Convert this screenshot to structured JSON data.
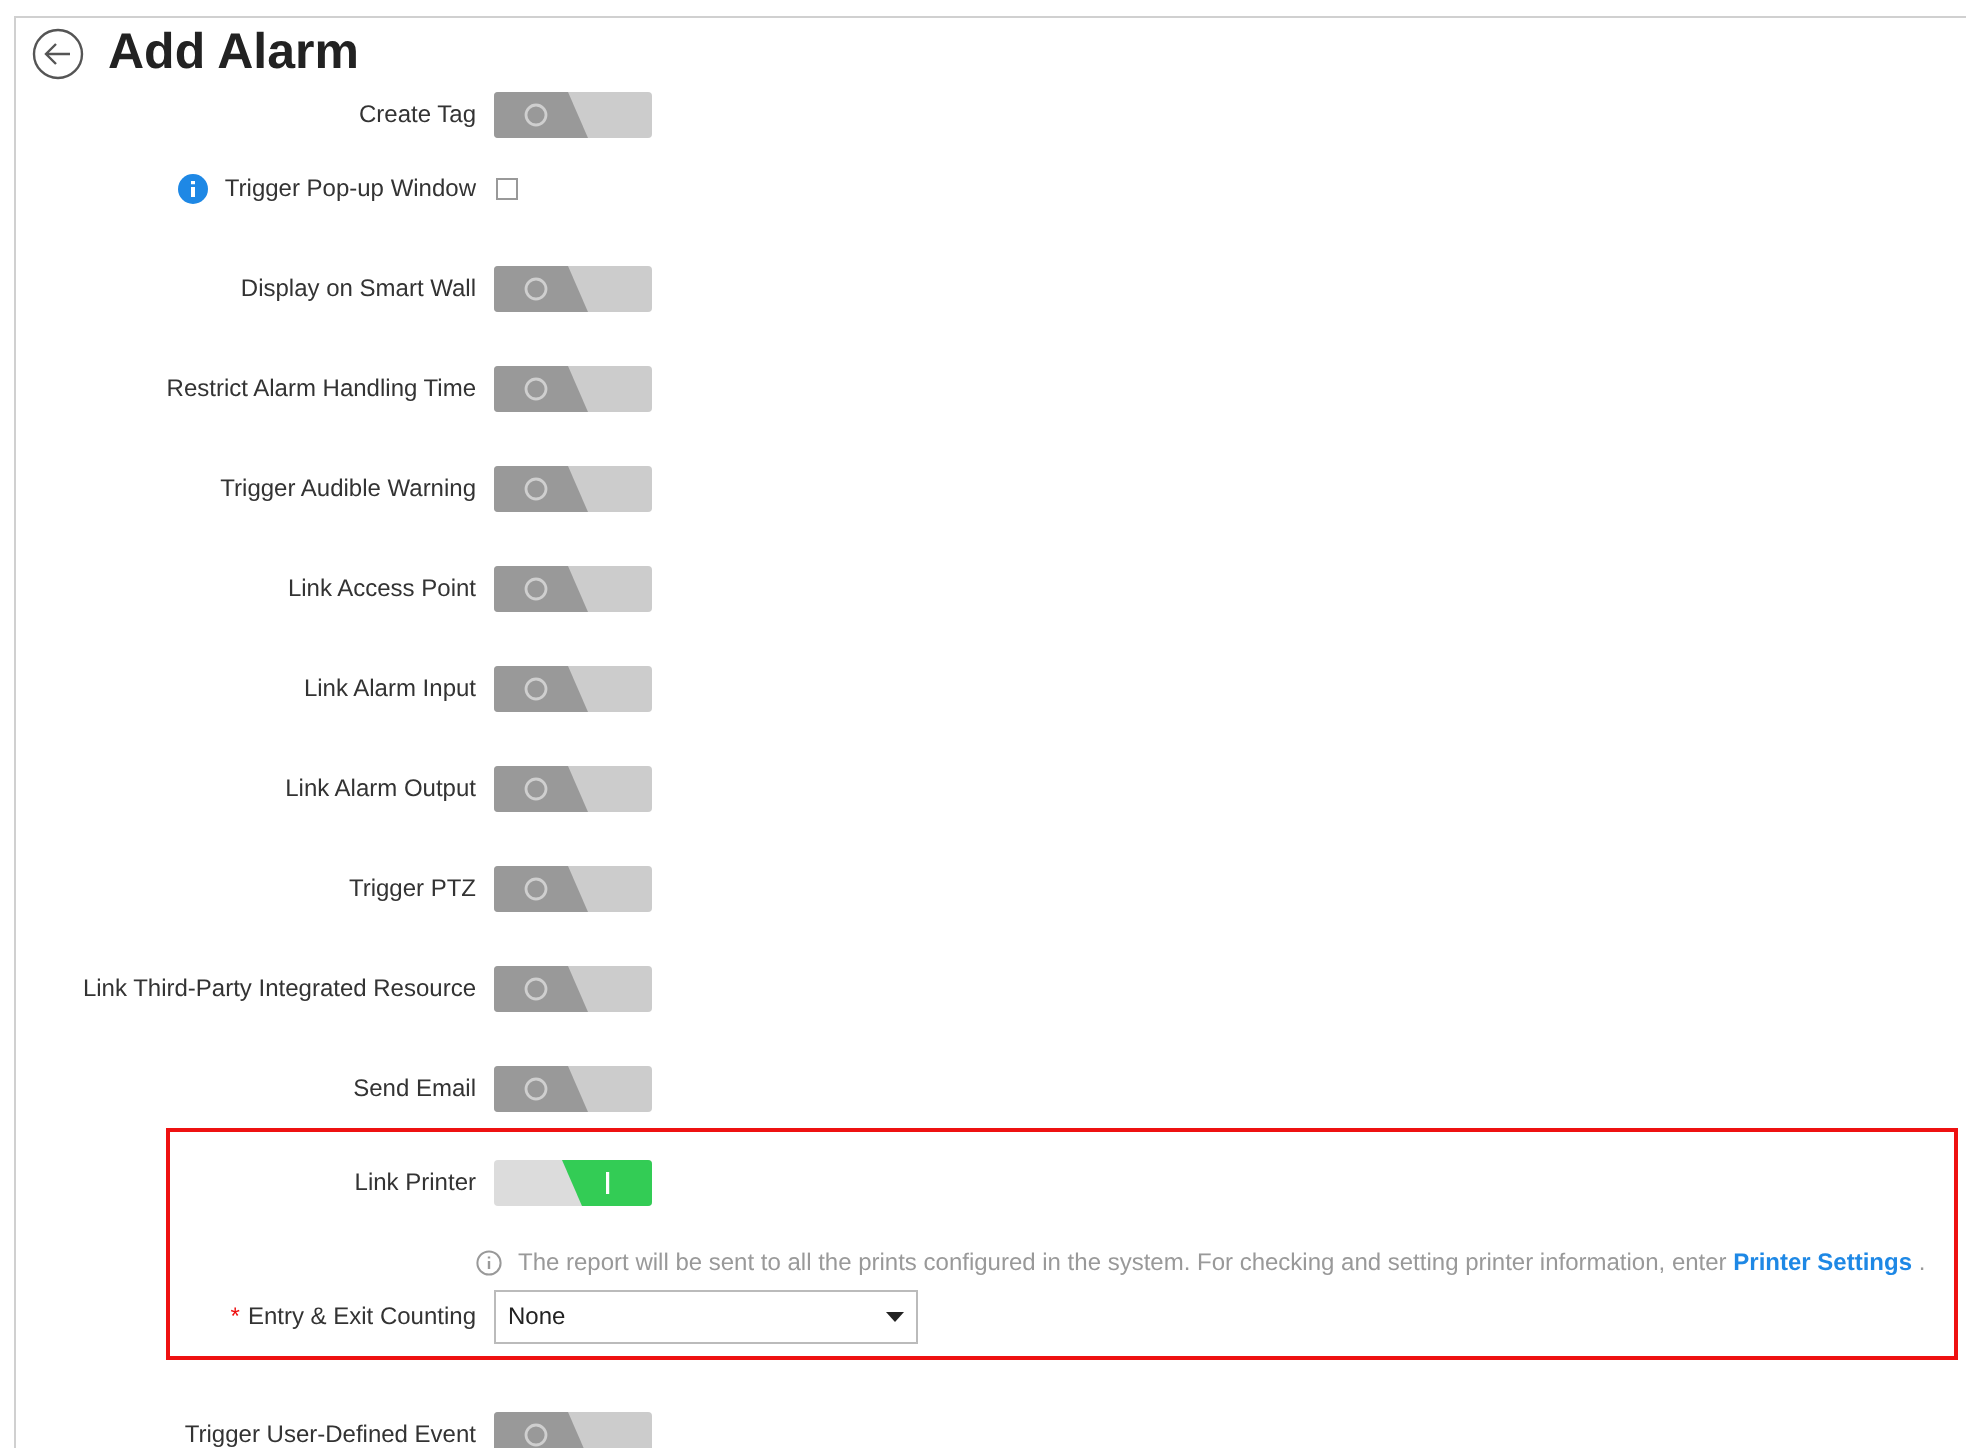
{
  "title": "Add Alarm",
  "rows": [
    {
      "kind": "toggle",
      "label": "Create Tag",
      "on": false
    },
    {
      "kind": "checkbox",
      "label": "Trigger Pop-up Window",
      "info": true,
      "checked": false
    },
    {
      "kind": "toggle",
      "label": "Display on Smart Wall",
      "on": false
    },
    {
      "kind": "toggle",
      "label": "Restrict Alarm Handling Time",
      "on": false
    },
    {
      "kind": "toggle",
      "label": "Trigger Audible Warning",
      "on": false
    },
    {
      "kind": "toggle",
      "label": "Link Access Point",
      "on": false
    },
    {
      "kind": "toggle",
      "label": "Link Alarm Input",
      "on": false
    },
    {
      "kind": "toggle",
      "label": "Link Alarm Output",
      "on": false
    },
    {
      "kind": "toggle",
      "label": "Trigger PTZ",
      "on": false
    },
    {
      "kind": "toggle",
      "label": "Link Third-Party Integrated Resource",
      "on": false
    },
    {
      "kind": "toggle",
      "label": "Send Email",
      "on": false
    }
  ],
  "printer": {
    "label": "Link Printer",
    "on": true,
    "note": "The report will be sent to all the prints configured in the system. For checking and setting printer information, enter",
    "link": "Printer Settings",
    "note_end": ".",
    "field_label": "Entry & Exit Counting",
    "required": "*",
    "field_value": "None"
  },
  "after": [
    {
      "kind": "toggle",
      "label": "Trigger User-Defined Event",
      "on": false
    }
  ]
}
